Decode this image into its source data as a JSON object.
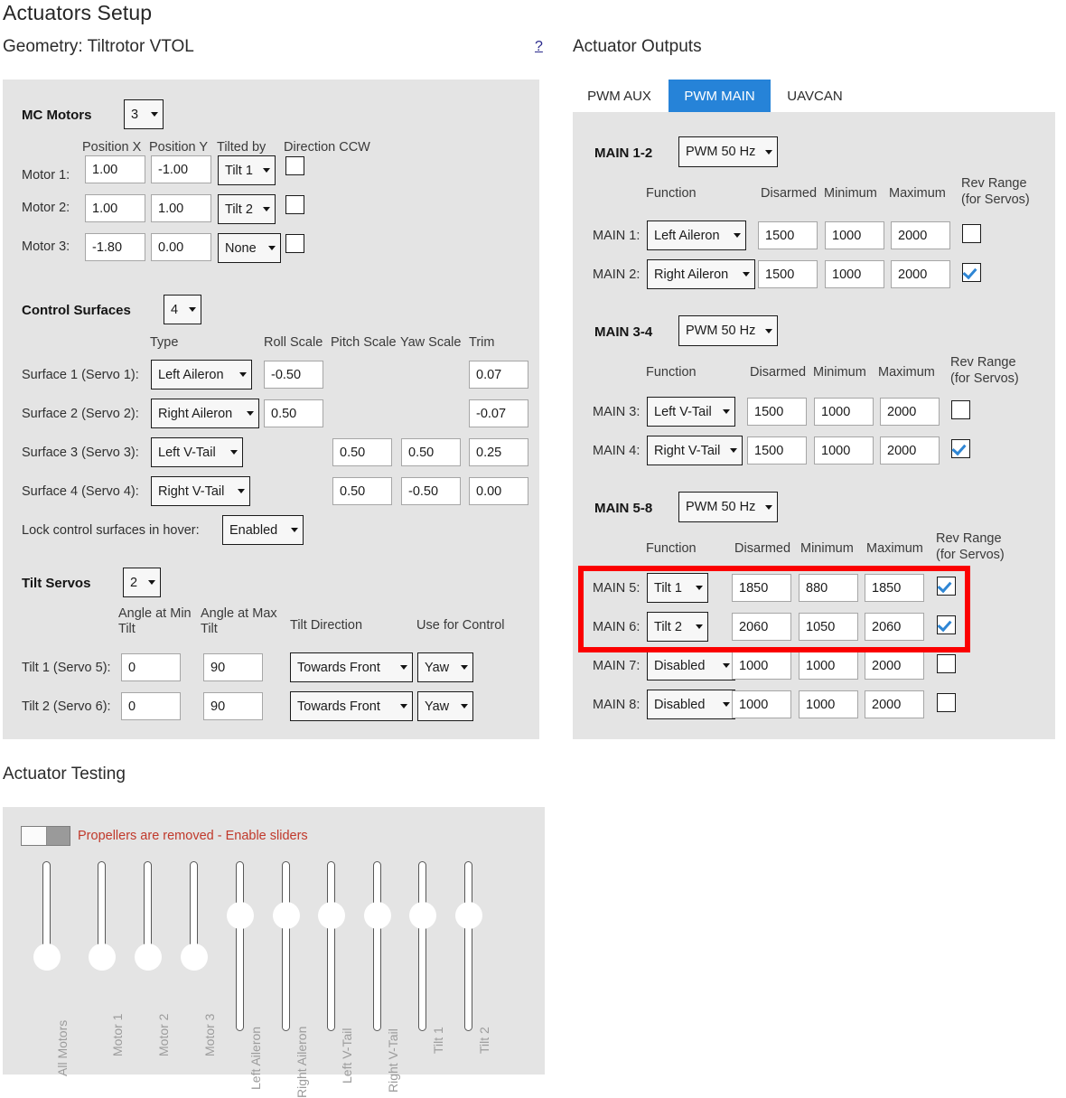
{
  "page": {
    "title": "Actuators Setup",
    "geometry_label": "Geometry: Tiltrotor VTOL",
    "help_link": "?",
    "outputs_title": "Actuator Outputs",
    "testing_title": "Actuator Testing"
  },
  "colors": {
    "panel_bg": "#e4e4e4",
    "tab_active_bg": "#2683d8",
    "highlight_border": "#fb0000",
    "warning_text": "#c0392b",
    "checkbox_check": "#2f86d4",
    "link": "#2a2a8c"
  },
  "mc_motors": {
    "title": "MC Motors",
    "count": "3",
    "headers": {
      "position_x": "Position X",
      "position_y": "Position Y",
      "tilted_by": "Tilted by",
      "direction_ccw": "Direction CCW"
    },
    "rows": [
      {
        "label": "Motor 1:",
        "position_x": "1.00",
        "position_y": "-1.00",
        "tilted_by": "Tilt 1",
        "ccw": false
      },
      {
        "label": "Motor 2:",
        "position_x": "1.00",
        "position_y": "1.00",
        "tilted_by": "Tilt 2",
        "ccw": false
      },
      {
        "label": "Motor 3:",
        "position_x": "-1.80",
        "position_y": "0.00",
        "tilted_by": "None",
        "ccw": false
      }
    ]
  },
  "control_surfaces": {
    "title": "Control Surfaces",
    "count": "4",
    "headers": {
      "type": "Type",
      "roll_scale": "Roll Scale",
      "pitch_scale": "Pitch Scale",
      "yaw_scale": "Yaw Scale",
      "trim": "Trim"
    },
    "rows": [
      {
        "label": "Surface 1 (Servo 1):",
        "type": "Left Aileron",
        "roll": "-0.50",
        "pitch": "",
        "yaw": "",
        "trim": "0.07"
      },
      {
        "label": "Surface 2 (Servo 2):",
        "type": "Right Aileron",
        "roll": "0.50",
        "pitch": "",
        "yaw": "",
        "trim": "-0.07"
      },
      {
        "label": "Surface 3 (Servo 3):",
        "type": "Left V-Tail",
        "roll": "",
        "pitch": "0.50",
        "yaw": "0.50",
        "trim": "0.25"
      },
      {
        "label": "Surface 4 (Servo 4):",
        "type": "Right V-Tail",
        "roll": "",
        "pitch": "0.50",
        "yaw": "-0.50",
        "trim": "0.00"
      }
    ],
    "lock_label": "Lock control surfaces in hover:",
    "lock_value": "Enabled"
  },
  "tilt_servos": {
    "title": "Tilt Servos",
    "count": "2",
    "headers": {
      "angle_min": "Angle at Min Tilt",
      "angle_max": "Angle at Max Tilt",
      "direction": "Tilt Direction",
      "use_for_control": "Use for Control"
    },
    "rows": [
      {
        "label": "Tilt 1 (Servo 5):",
        "angle_min": "0",
        "angle_max": "90",
        "direction": "Towards Front",
        "use_for_control": "Yaw"
      },
      {
        "label": "Tilt 2 (Servo 6):",
        "angle_min": "0",
        "angle_max": "90",
        "direction": "Towards Front",
        "use_for_control": "Yaw"
      }
    ]
  },
  "actuator_outputs": {
    "tabs": [
      {
        "label": "PWM AUX",
        "active": false
      },
      {
        "label": "PWM MAIN",
        "active": true
      },
      {
        "label": "UAVCAN",
        "active": false
      }
    ],
    "column_headers": {
      "function": "Function",
      "disarmed": "Disarmed",
      "minimum": "Minimum",
      "maximum": "Maximum",
      "rev_range_line1": "Rev Range",
      "rev_range_line2": "(for Servos)"
    },
    "groups": [
      {
        "name": "MAIN 1-2",
        "rate": "PWM 50 Hz",
        "rows": [
          {
            "label": "MAIN 1:",
            "function": "Left Aileron",
            "disarmed": "1500",
            "minimum": "1000",
            "maximum": "2000",
            "rev": false
          },
          {
            "label": "MAIN 2:",
            "function": "Right Aileron",
            "disarmed": "1500",
            "minimum": "1000",
            "maximum": "2000",
            "rev": true
          }
        ]
      },
      {
        "name": "MAIN 3-4",
        "rate": "PWM 50 Hz",
        "rows": [
          {
            "label": "MAIN 3:",
            "function": "Left V-Tail",
            "disarmed": "1500",
            "minimum": "1000",
            "maximum": "2000",
            "rev": false
          },
          {
            "label": "MAIN 4:",
            "function": "Right V-Tail",
            "disarmed": "1500",
            "minimum": "1000",
            "maximum": "2000",
            "rev": true
          }
        ]
      },
      {
        "name": "MAIN 5-8",
        "rate": "PWM 50 Hz",
        "rows": [
          {
            "label": "MAIN 5:",
            "function": "Tilt 1",
            "disarmed": "1850",
            "minimum": "880",
            "maximum": "1850",
            "rev": true,
            "highlighted": true
          },
          {
            "label": "MAIN 6:",
            "function": "Tilt 2",
            "disarmed": "2060",
            "minimum": "1050",
            "maximum": "2060",
            "rev": true,
            "highlighted": true
          },
          {
            "label": "MAIN 7:",
            "function": "Disabled",
            "disarmed": "1000",
            "minimum": "1000",
            "maximum": "2000",
            "rev": false
          },
          {
            "label": "MAIN 8:",
            "function": "Disabled",
            "disarmed": "1000",
            "minimum": "1000",
            "maximum": "2000",
            "rev": false
          }
        ]
      }
    ]
  },
  "actuator_testing": {
    "toggle_state": "off",
    "warning": "Propellers are removed - Enable sliders",
    "sliders": [
      {
        "label": "All Motors",
        "position": "bottom"
      },
      {
        "label": "Motor 1",
        "position": "bottom"
      },
      {
        "label": "Motor 2",
        "position": "bottom"
      },
      {
        "label": "Motor 3",
        "position": "bottom"
      },
      {
        "label": "Left Aileron",
        "position": "middle"
      },
      {
        "label": "Right Aileron",
        "position": "middle"
      },
      {
        "label": "Left V-Tail",
        "position": "middle"
      },
      {
        "label": "Right V-Tail",
        "position": "middle"
      },
      {
        "label": "Tilt 1",
        "position": "middle"
      },
      {
        "label": "Tilt 2",
        "position": "middle"
      }
    ]
  }
}
